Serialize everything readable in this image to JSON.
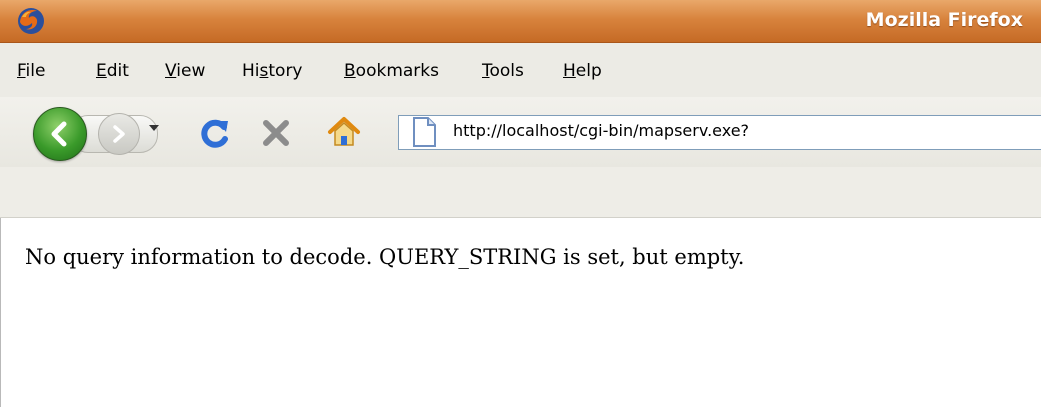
{
  "window": {
    "title": "Mozilla Firefox"
  },
  "menu": {
    "items": [
      {
        "pre": "",
        "acc": "F",
        "post": "ile"
      },
      {
        "pre": "",
        "acc": "E",
        "post": "dit"
      },
      {
        "pre": "",
        "acc": "V",
        "post": "iew"
      },
      {
        "pre": "Hi",
        "acc": "s",
        "post": "tory"
      },
      {
        "pre": "",
        "acc": "B",
        "post": "ookmarks"
      },
      {
        "pre": "",
        "acc": "T",
        "post": "ools"
      },
      {
        "pre": "",
        "acc": "H",
        "post": "elp"
      }
    ]
  },
  "navigation": {
    "url": "http://localhost/cgi-bin/mapserv.exe?",
    "icons": {
      "back": "back-arrow-icon",
      "forward": "forward-arrow-icon",
      "history": "chevron-down-icon",
      "reload": "reload-icon",
      "stop": "stop-icon",
      "home": "home-icon",
      "page": "page-icon"
    }
  },
  "content": {
    "message": "No query information to decode. QUERY_STRING is set, but empty."
  },
  "colors": {
    "titlebar": "#d8833d",
    "reload": "#2f6fd6",
    "stop": "#8c8c8c",
    "back": "#3a9a2a"
  }
}
